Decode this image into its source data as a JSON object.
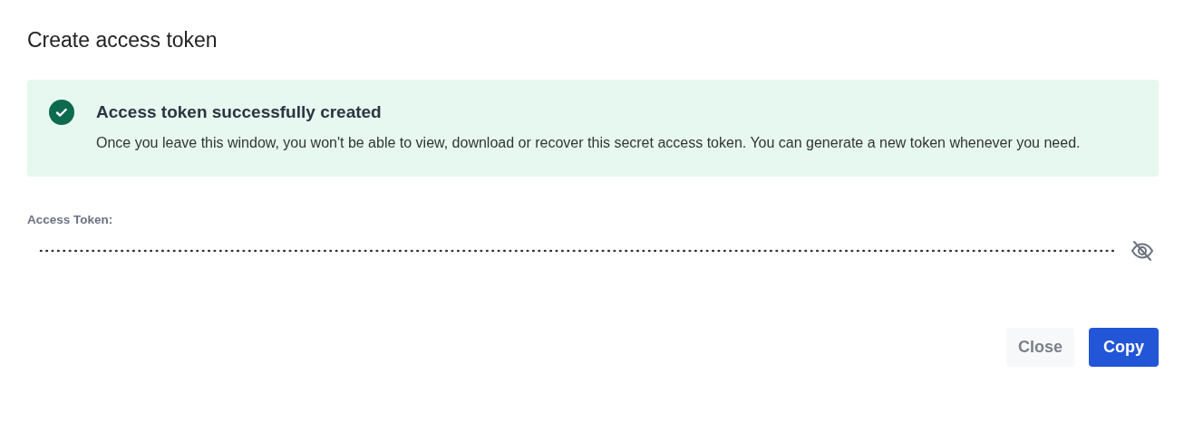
{
  "dialog": {
    "title": "Create access token"
  },
  "alert": {
    "kind": "success",
    "title": "Access token successfully created",
    "message": "Once you leave this window, you won't be able to view, download or recover this secret access token. You can generate a new token whenever you need."
  },
  "token_field": {
    "label": "Access Token:",
    "masked": true
  },
  "buttons": [
    {
      "label": "Close",
      "kind": "secondary"
    },
    {
      "label": "Copy",
      "kind": "primary"
    }
  ]
}
